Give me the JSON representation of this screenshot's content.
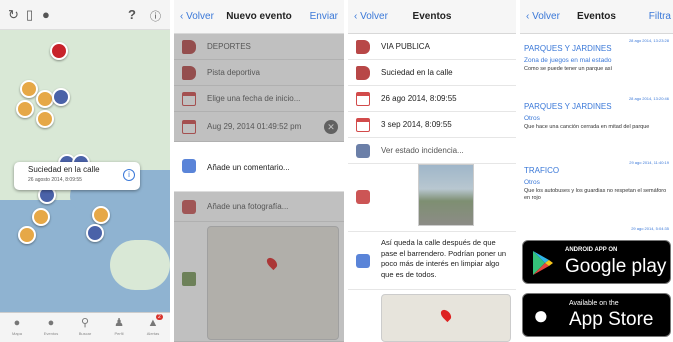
{
  "map_screen": {
    "callout": {
      "title": "Suciedad en la calle",
      "date": "26 agosto 2014, 8:09:55"
    },
    "top_icons": [
      "refresh-icon",
      "phone-icon",
      "chat-icon",
      "help-icon",
      "info-icon"
    ],
    "tabs": [
      {
        "label": "Mapa",
        "icon": "speech-icon"
      },
      {
        "label": "Eventos",
        "icon": "chat-icon"
      },
      {
        "label": "Buscar",
        "icon": "search-icon"
      },
      {
        "label": "Perfil",
        "icon": "user-icon"
      },
      {
        "label": "Alertas",
        "icon": "alert-icon",
        "badge": "2"
      }
    ]
  },
  "nuevo_evento": {
    "back": "Volver",
    "title": "Nuevo evento",
    "send": "Enviar",
    "rows": {
      "category": "DEPORTES",
      "subcategory": "Pista deportiva",
      "start_placeholder": "Elige una fecha de inicio...",
      "date_value": "Aug 29, 2014 01:49:52 pm",
      "comment_placeholder": "Añade un comentario...",
      "photo_placeholder": "Añade una fotografía..."
    }
  },
  "eventos_detail": {
    "back": "Volver",
    "title": "Eventos",
    "category": "VIA PUBLICA",
    "subcategory": "Suciedad en la calle",
    "date_start": "26 ago 2014, 8:09:55",
    "date_end": "3 sep 2014, 8:09:55",
    "status_link": "Ver estado incidencia...",
    "comment": "Así queda la calle después de que pase el barrendero. Podrían poner un poco más de interés en limpiar algo que es de todos."
  },
  "eventos_list": {
    "back": "Volver",
    "title": "Eventos",
    "filter": "Filtra",
    "items": [
      {
        "date": "28 ago 2014, 13:23:28",
        "category": "PARQUES Y JARDINES",
        "sub": "Zona de juegos en mal estado",
        "desc": "Como se puede tener un parque así"
      },
      {
        "date": "28 ago 2014, 13:20:46",
        "category": "PARQUES Y JARDINES",
        "sub": "Otros",
        "desc": "Que hace una canción cerrada en mitad del parque"
      },
      {
        "date": "29 ago 2014, 11:40:19",
        "category": "TRAFICO",
        "sub": "Otros",
        "desc": "Que los autobuses y los guardias no respetan el semáforo en rojo"
      },
      {
        "date": "29 ago 2014, 5:04:35",
        "category": "",
        "sub": "",
        "desc": ""
      }
    ],
    "google_badge": {
      "small": "ANDROID APP ON",
      "big": "Google play"
    },
    "apple_badge": {
      "small": "Available on the",
      "big": "App Store"
    }
  },
  "colors": {
    "accent": "#3a78d8",
    "tag_red": "#b84747",
    "pin_orange": "#e6a847",
    "pin_blue": "#4a62a8"
  }
}
